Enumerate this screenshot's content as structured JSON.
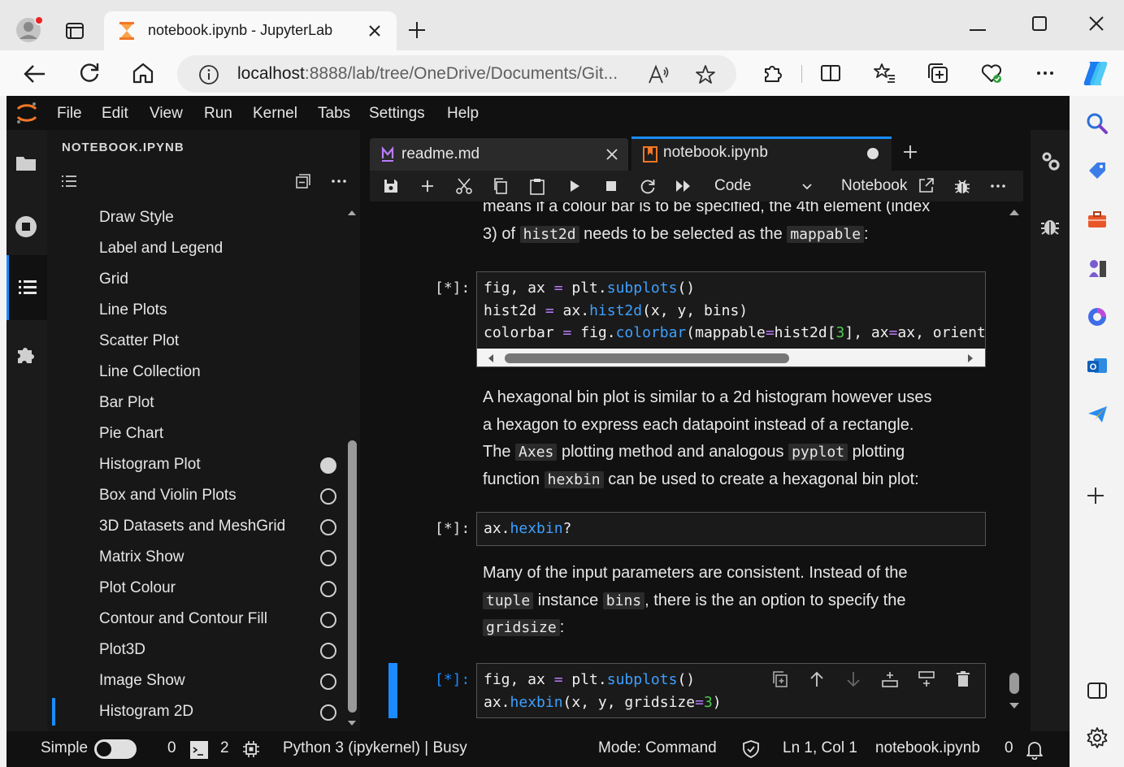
{
  "browser": {
    "tab_title": "notebook.ipynb - JupyterLab",
    "url_host": "localhost",
    "url_rest": ":8888/lab/tree/OneDrive/Documents/Git..."
  },
  "menubar": [
    "File",
    "Edit",
    "View",
    "Run",
    "Kernel",
    "Tabs",
    "Settings",
    "Help"
  ],
  "toc": {
    "title": "NOTEBOOK.IPYNB",
    "items": [
      {
        "label": "Draw Style",
        "state": "none"
      },
      {
        "label": "Label and Legend",
        "state": "none"
      },
      {
        "label": "Grid",
        "state": "none"
      },
      {
        "label": "Line Plots",
        "state": "none"
      },
      {
        "label": "Scatter Plot",
        "state": "none"
      },
      {
        "label": "Line Collection",
        "state": "none"
      },
      {
        "label": "Bar Plot",
        "state": "none"
      },
      {
        "label": "Pie Chart",
        "state": "none"
      },
      {
        "label": "Histogram Plot",
        "state": "filled"
      },
      {
        "label": "Box and Violin Plots",
        "state": "empty"
      },
      {
        "label": "3D Datasets and MeshGrid",
        "state": "empty"
      },
      {
        "label": "Matrix Show",
        "state": "empty"
      },
      {
        "label": "Plot Colour",
        "state": "empty"
      },
      {
        "label": "Contour and Contour Fill",
        "state": "empty"
      },
      {
        "label": "Plot3D",
        "state": "empty"
      },
      {
        "label": "Image Show",
        "state": "empty"
      },
      {
        "label": "Histogram 2D",
        "state": "empty"
      }
    ]
  },
  "doc_tabs": [
    {
      "label": "readme.md",
      "active": false
    },
    {
      "label": "notebook.ipynb",
      "active": true
    }
  ],
  "nb_toolbar": {
    "cell_type": "Code",
    "notebook_label": "Notebook"
  },
  "cells": {
    "md1": {
      "l1": "means if a colour bar is to be specified, the 4th element (index",
      "l2a": "3) of ",
      "l2code1": "hist2d",
      "l2b": " needs to be selected as the ",
      "l2code2": "mappable",
      "l2c": ":"
    },
    "code1": {
      "prompt": "[*]:",
      "l1a": "fig, ax ",
      "l1op": "=",
      "l1b": " plt.",
      "l1fn": "subplots",
      "l1c": "()",
      "l2a": "hist2d ",
      "l2op": "=",
      "l2b": " ax.",
      "l2fn": "hist2d",
      "l2c": "(x, y, bins)",
      "l3a": "colorbar ",
      "l3op": "=",
      "l3b": " fig.",
      "l3fn": "colorbar",
      "l3c": "(mappable",
      "l3op2": "=",
      "l3d": "hist2d[",
      "l3num": "3",
      "l3e": "], ax",
      "l3op3": "=",
      "l3f": "ax, orienta"
    },
    "md2": {
      "l1": "A hexagonal bin plot is similar to a 2d histogram however uses",
      "l2": "a hexagon to express each datapoint instead of a rectangle.",
      "l3a": "The ",
      "l3code1": "Axes",
      "l3b": " plotting method and analogous ",
      "l3code2": "pyplot",
      "l3c": " plotting",
      "l4a": "function ",
      "l4code": "hexbin",
      "l4b": " can be used to create a hexagonal bin plot:"
    },
    "code2": {
      "prompt": "[*]:",
      "a": "ax.",
      "fn": "hexbin",
      "b": "?"
    },
    "md3": {
      "l1": "Many of the input parameters are consistent. Instead of the",
      "l2code1": "tuple",
      "l2a": " instance ",
      "l2code2": "bins",
      "l2b": ", there is the an option to specify the",
      "l3code": "gridsize",
      "l3a": ":"
    },
    "code3": {
      "prompt": "[*]:",
      "l1a": "fig, ax ",
      "l1op": "=",
      "l1b": " plt.",
      "l1fn": "subplots",
      "l1c": "()",
      "l2a": "ax.",
      "l2fn": "hexbin",
      "l2b": "(x, y, gridsize",
      "l2op": "=",
      "l2num": "3",
      "l2c": ")"
    }
  },
  "status": {
    "simple_label": "Simple",
    "terminals": "0",
    "kernels": "2",
    "kernel": "Python 3 (ipykernel) | Busy",
    "mode": "Mode: Command",
    "cursor": "Ln 1, Col 1",
    "file": "notebook.ipynb",
    "notifications": "0"
  },
  "colors": {
    "accent": "#1a8cff",
    "jupyter_orange": "#f37726",
    "bg": "#111111"
  }
}
